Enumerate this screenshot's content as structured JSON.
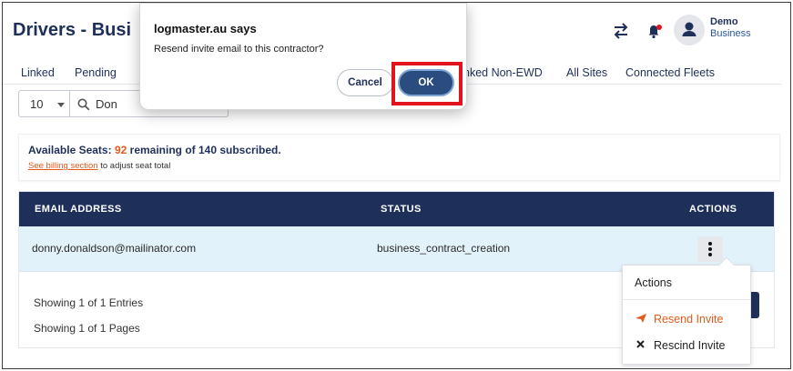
{
  "page": {
    "title": "Drivers - Busi"
  },
  "header": {
    "user_name": "Demo",
    "user_org": "Business"
  },
  "tabs": [
    {
      "label": "Linked"
    },
    {
      "label": "Pending"
    },
    {
      "label": "nked Non-EWD"
    },
    {
      "label": "All Sites"
    },
    {
      "label": "Connected Fleets"
    }
  ],
  "filters": {
    "page_size": "10",
    "search_value": "Don"
  },
  "seats": {
    "label": "Available Seats:",
    "remaining": "92",
    "suffix": "remaining of 140 subscribed.",
    "billing_link": "See billing section",
    "billing_suffix": "to adjust seat total"
  },
  "table": {
    "columns": [
      "EMAIL ADDRESS",
      "STATUS",
      "ACTIONS"
    ],
    "rows": [
      {
        "email": "donny.donaldson@mailinator.com",
        "status": "business_contract_creation"
      }
    ],
    "entries_text": "Showing 1 of 1 Entries",
    "pages_text": "Showing 1 of 1 Pages"
  },
  "actions_menu": {
    "title": "Actions",
    "items": [
      {
        "label": "Resend Invite",
        "icon": "send-icon"
      },
      {
        "label": "Rescind Invite",
        "icon": "close-icon"
      }
    ]
  },
  "dialog": {
    "title": "logmaster.au says",
    "message": "Resend invite email to this contractor?",
    "cancel_label": "Cancel",
    "ok_label": "OK"
  },
  "colors": {
    "navy": "#1e2f5a",
    "accent": "#e25a1c",
    "row_highlight": "#e2f2fa",
    "annotation_red": "#e0141f"
  }
}
